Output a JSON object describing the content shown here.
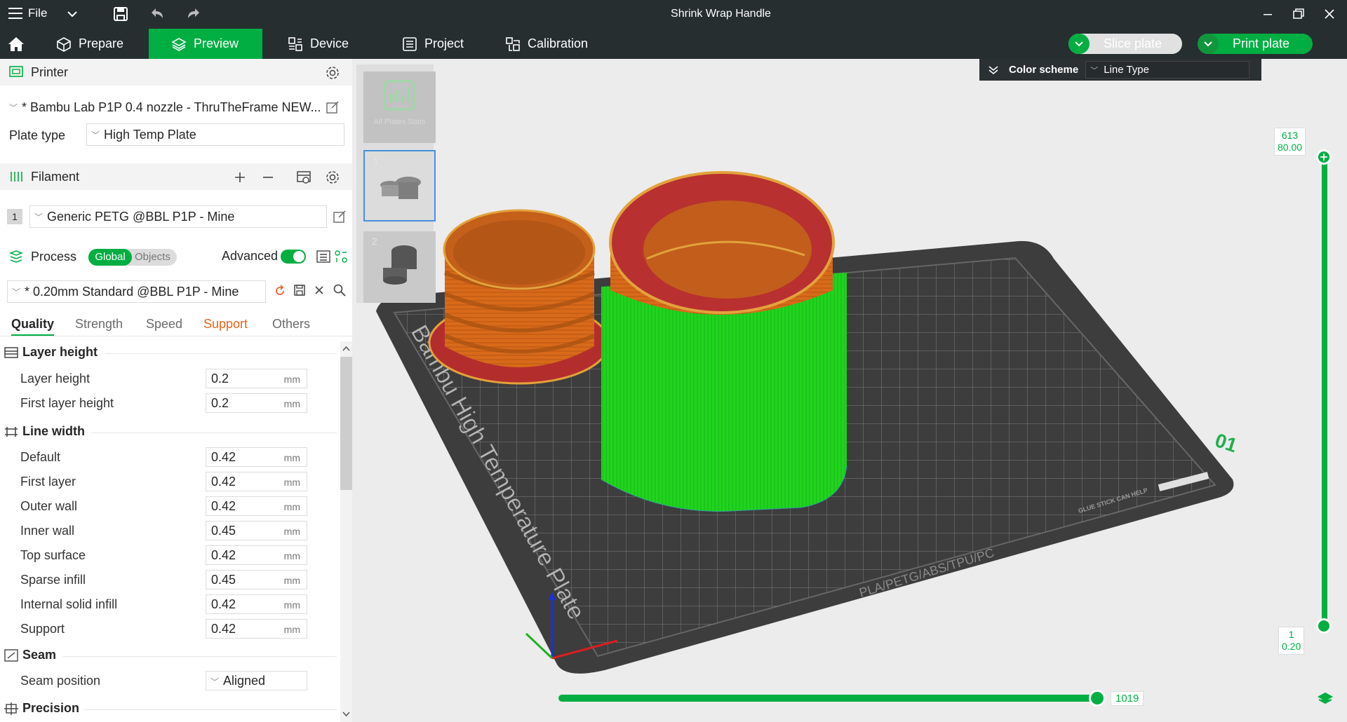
{
  "titlebar": {
    "file_label": "File",
    "title": "Shrink Wrap Handle"
  },
  "tabs": [
    {
      "label": "Prepare"
    },
    {
      "label": "Preview"
    },
    {
      "label": "Device"
    },
    {
      "label": "Project"
    },
    {
      "label": "Calibration"
    }
  ],
  "actions": {
    "slice_label": "Slice plate",
    "print_label": "Print plate"
  },
  "printer": {
    "header": "Printer",
    "preset": "* Bambu Lab P1P 0.4 nozzle - ThruTheFrame NEW...",
    "plate_type_label": "Plate type",
    "plate_type_value": "High Temp Plate"
  },
  "filament": {
    "header": "Filament",
    "index": "1",
    "preset": "Generic PETG @BBL P1P - Mine"
  },
  "process": {
    "header": "Process",
    "toggle_global": "Global",
    "toggle_objects": "Objects",
    "advanced_label": "Advanced",
    "preset": "* 0.20mm Standard @BBL P1P - Mine",
    "subtabs": [
      "Quality",
      "Strength",
      "Speed",
      "Support",
      "Others"
    ]
  },
  "settings": {
    "unit": "mm",
    "layer_height_group": "Layer height",
    "layer_height_label": "Layer height",
    "layer_height_value": "0.2",
    "first_layer_height_label": "First layer height",
    "first_layer_height_value": "0.2",
    "line_width_group": "Line width",
    "lw_default_label": "Default",
    "lw_default_value": "0.42",
    "lw_first_label": "First layer",
    "lw_first_value": "0.42",
    "lw_outer_label": "Outer wall",
    "lw_outer_value": "0.42",
    "lw_inner_label": "Inner wall",
    "lw_inner_value": "0.45",
    "lw_top_label": "Top surface",
    "lw_top_value": "0.42",
    "lw_sparse_label": "Sparse infill",
    "lw_sparse_value": "0.45",
    "lw_internal_label": "Internal solid infill",
    "lw_internal_value": "0.42",
    "lw_support_label": "Support",
    "lw_support_value": "0.42",
    "seam_group": "Seam",
    "seam_position_label": "Seam position",
    "seam_position_value": "Aligned",
    "precision_group": "Precision"
  },
  "viewport": {
    "color_scheme_label": "Color scheme",
    "color_scheme_value": "Line Type",
    "plate_text": "Bambu High Temperature Plate",
    "plate_number": "01",
    "material_strip": "PLA/PETG/ABS/TPU/PC",
    "glue_notice": "GLUE STICK CAN HELP",
    "thumb_stats": "All Plates Stats",
    "thumb_1_num": "1",
    "thumb_2_num": "2",
    "layer_top_count": "613",
    "layer_top_height": "80.00",
    "layer_bottom_count": "1",
    "layer_bottom_height": "0.20",
    "move_count": "1019"
  },
  "colors": {
    "accent": "#00ae42",
    "support": "#ff6f00",
    "bar": "#262e30"
  }
}
